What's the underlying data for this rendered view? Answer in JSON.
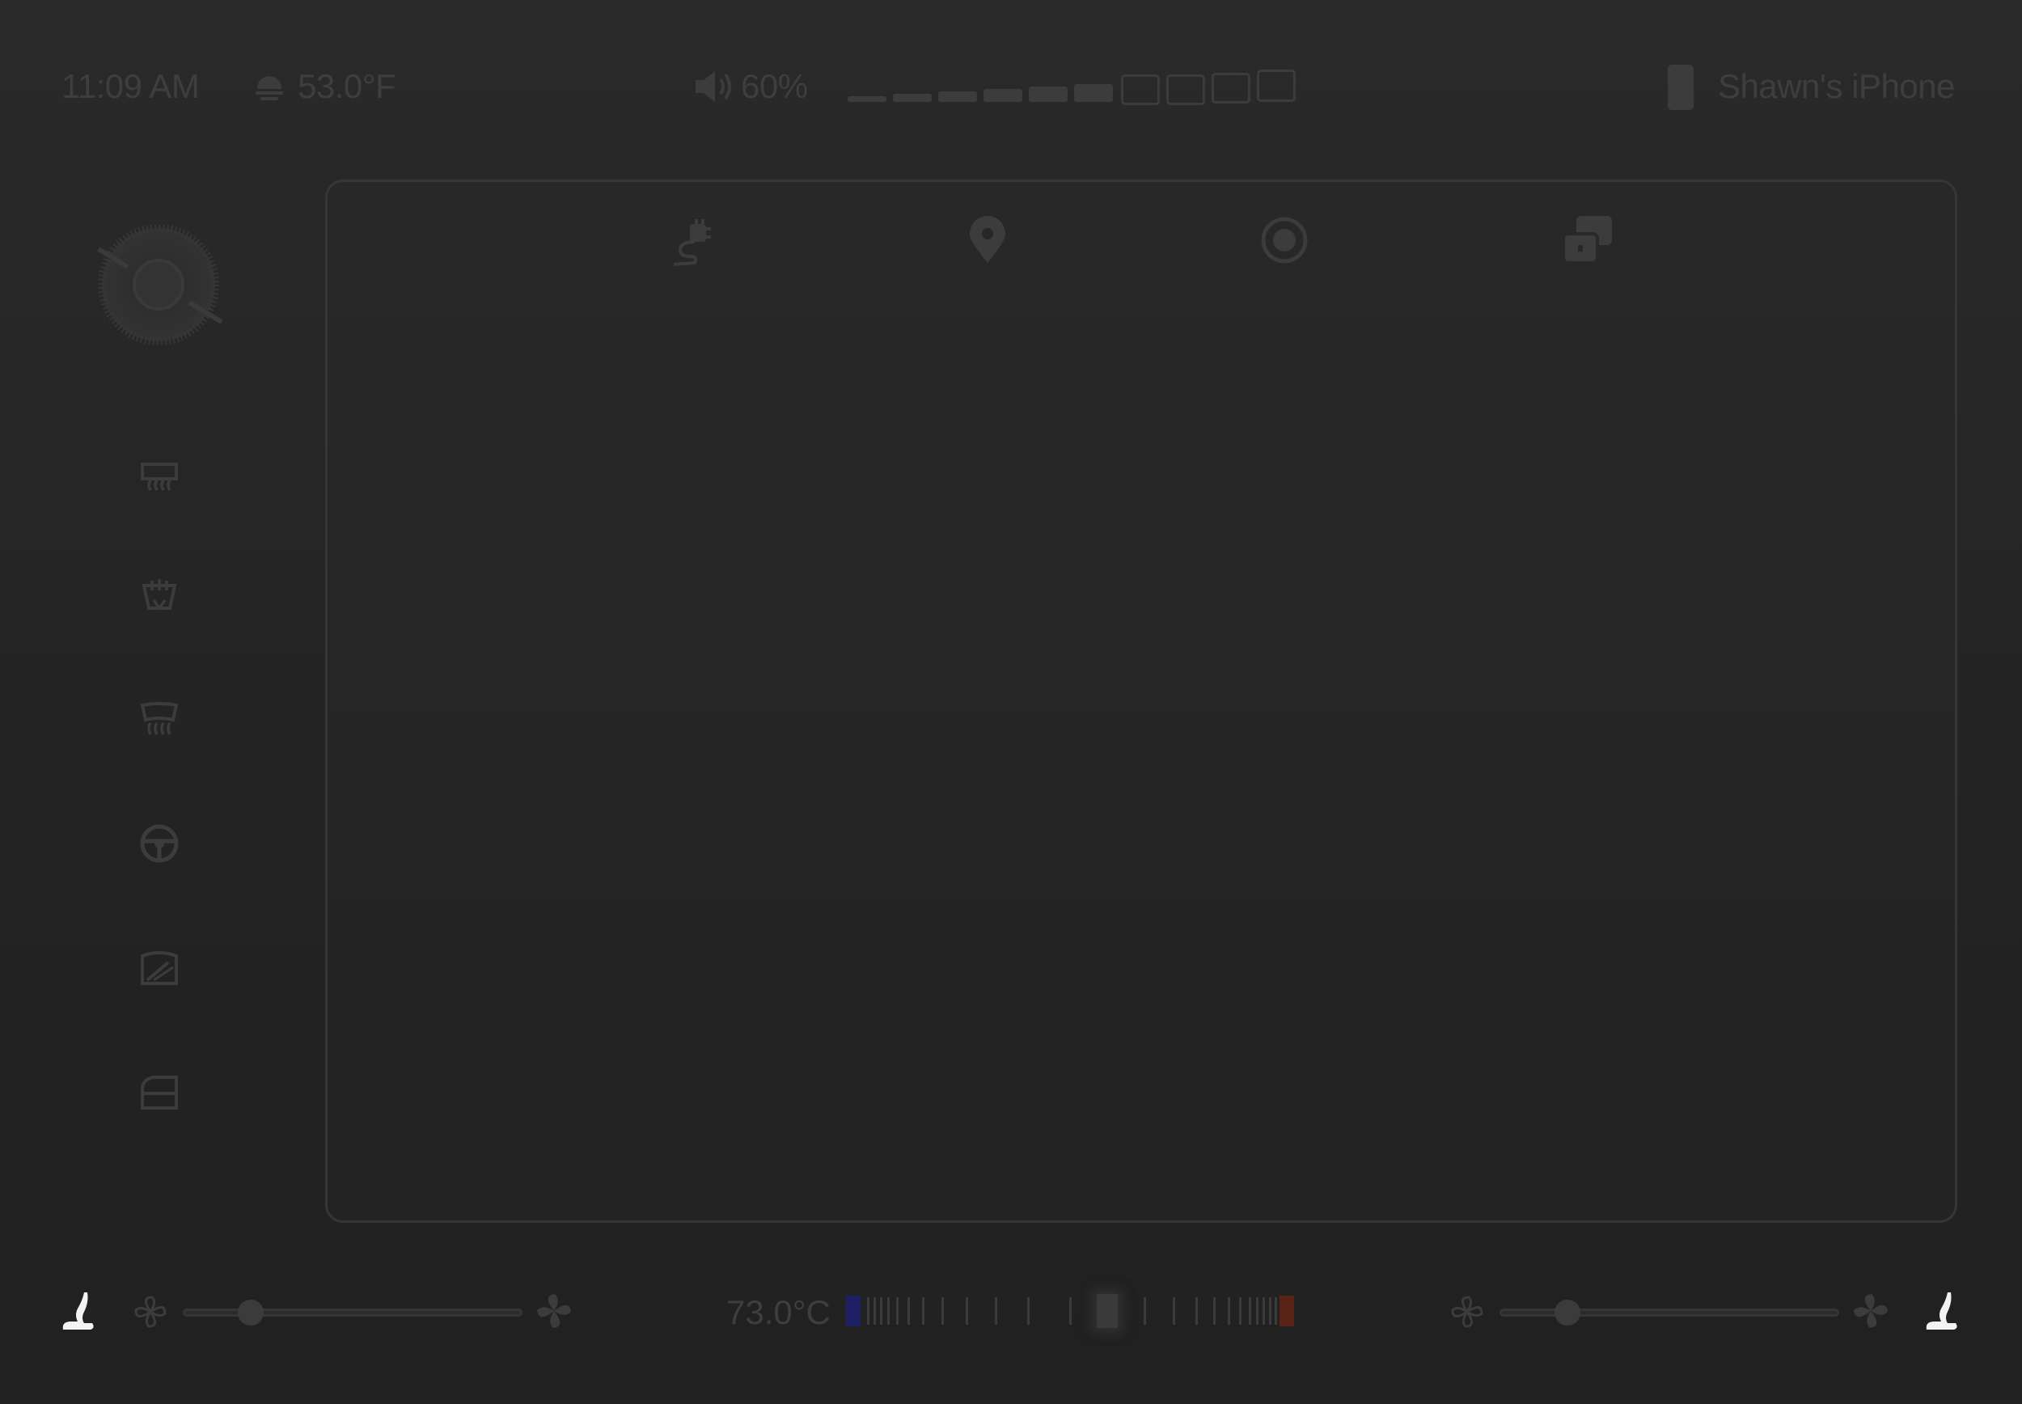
{
  "status_bar": {
    "time": "11:09 AM",
    "weather_icon": "cloud-icon",
    "outside_temp": "53.0°F",
    "volume_icon": "speaker-icon",
    "volume_level": "60%",
    "volume_value": 0.6,
    "phone_icon": "phone-icon",
    "connected_device": "Shawn's iPhone"
  },
  "sidebar": {
    "items": [
      {
        "icon": "fan-dial-icon"
      },
      {
        "icon": "front-defrost-icon"
      },
      {
        "icon": "cabin-air-icon"
      },
      {
        "icon": "rear-defrost-icon"
      },
      {
        "icon": "steering-wheel-heat-icon"
      },
      {
        "icon": "wiper-icon"
      },
      {
        "icon": "window-icon"
      }
    ]
  },
  "main_card": {
    "tabs": [
      {
        "icon": "charging-plug-icon"
      },
      {
        "icon": "location-pin-icon"
      },
      {
        "icon": "camera-icon"
      },
      {
        "icon": "apps-icon"
      }
    ]
  },
  "climate": {
    "left_seat_icon": "seat-heater-icon",
    "left_fan_min_icon": "fan-small-icon",
    "left_fan_max_icon": "fan-large-icon",
    "left_fan_level": 0.2,
    "temperature": "73.0°C",
    "temperature_position": 0.5,
    "right_fan_min_icon": "fan-small-icon",
    "right_fan_max_icon": "fan-large-icon",
    "right_fan_level": 0.2,
    "right_seat_icon": "seat-heater-icon",
    "cold_color": "#1f1f66",
    "hot_color": "#5a2318"
  }
}
